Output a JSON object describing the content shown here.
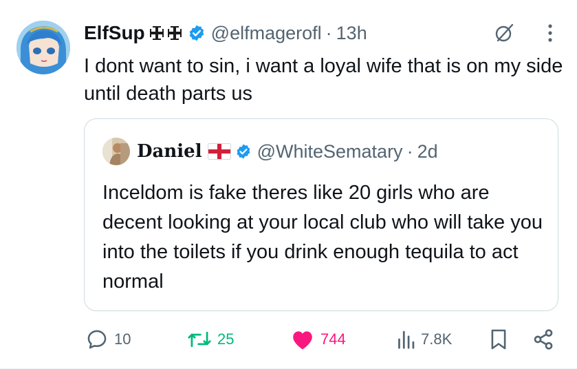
{
  "tweet": {
    "display_name": "ElfSup",
    "handle": "@elfmagerofl",
    "separator": "·",
    "time": "13h",
    "text": "I dont want to sin, i want a loyal wife that is on my side until death parts us"
  },
  "quote": {
    "display_name": "Daniel",
    "handle": "@WhiteSematary",
    "separator": "·",
    "time": "2d",
    "text": "Inceldom is fake theres like 20 girls who are decent looking at your local club who will take you into the toilets if you drink enough tequila to act normal"
  },
  "actions": {
    "replies": "10",
    "reposts": "25",
    "likes": "744",
    "views": "7.8K"
  },
  "colors": {
    "verified": "#1d9bf0",
    "repost": "#00ba7c",
    "like": "#f91880",
    "muted": "#536471"
  },
  "icons": [
    "jerusalem-cross-emoji",
    "verified-badge-icon",
    "grok-icon",
    "more-icon",
    "england-flag-emoji",
    "reply-icon",
    "repost-icon",
    "like-icon",
    "views-icon",
    "bookmark-icon",
    "share-icon"
  ]
}
